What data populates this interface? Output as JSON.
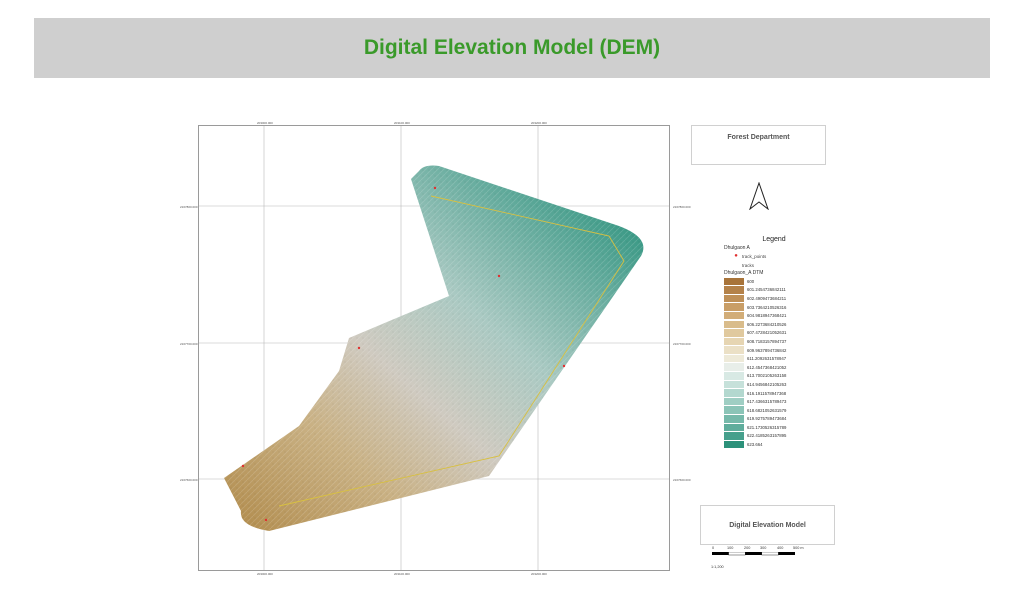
{
  "header": {
    "title": "Digital Elevation Model (DEM)"
  },
  "colors": {
    "banner_bg": "#cfcfcf",
    "title_green": "#3a9a2a",
    "track_points": "#e03030",
    "track_line": "#d8c040"
  },
  "map": {
    "coords_top": [
      "203000.000",
      "203100.000",
      "203200.000"
    ],
    "coords_bottom": [
      "203000.000",
      "203100.000",
      "203200.000"
    ],
    "coords_left": [
      "2167800.000",
      "2167700.000",
      "2167600.000"
    ],
    "coords_right": [
      "2167800.000",
      "2167700.000",
      "2167600.000"
    ]
  },
  "panel": {
    "department": "Forest Department",
    "north_arrow": "north-arrow-icon",
    "legend": {
      "title": "Legend",
      "group_name": "Dhulgaon A",
      "track_points_label": "track_points",
      "tracks_label": "tracks",
      "dtm_name": "Dhulgaon_A DTM",
      "ramp": [
        {
          "label": "600",
          "color": "#a8743a"
        },
        {
          "label": "601.2454736842111",
          "color": "#b4824a"
        },
        {
          "label": "602.4909473684211",
          "color": "#bf9058"
        },
        {
          "label": "603.7364210526316",
          "color": "#c99e67"
        },
        {
          "label": "604.9818947368421",
          "color": "#d2ad78"
        },
        {
          "label": "606.2273684210526",
          "color": "#d9bc8b"
        },
        {
          "label": "607.4728421052631",
          "color": "#e0c99e"
        },
        {
          "label": "608.7183157894737",
          "color": "#e6d5b2"
        },
        {
          "label": "609.9637894736842",
          "color": "#ebe0c6"
        },
        {
          "label": "611.2092631578947",
          "color": "#eeead9"
        },
        {
          "label": "612.4547368421052",
          "color": "#e8eee9"
        },
        {
          "label": "613.7002105263158",
          "color": "#d8e9e4"
        },
        {
          "label": "614.9456842105263",
          "color": "#c6e1da"
        },
        {
          "label": "616.1911578947368",
          "color": "#b3d8cf"
        },
        {
          "label": "617.4366315789473",
          "color": "#9fcec3"
        },
        {
          "label": "618.6821052631579",
          "color": "#8bc4b7"
        },
        {
          "label": "619.9275789473684",
          "color": "#76b9aa"
        },
        {
          "label": "621.1730526315789",
          "color": "#5fad9c"
        },
        {
          "label": "622.4185263157895",
          "color": "#46a08c"
        },
        {
          "label": "623.664",
          "color": "#2c917a"
        }
      ]
    },
    "dem_label": "Digital Elevation Model",
    "scale": {
      "ticks": [
        "0",
        "100",
        "200",
        "300",
        "400",
        "500 m"
      ],
      "ratio": "1:1,200"
    }
  }
}
